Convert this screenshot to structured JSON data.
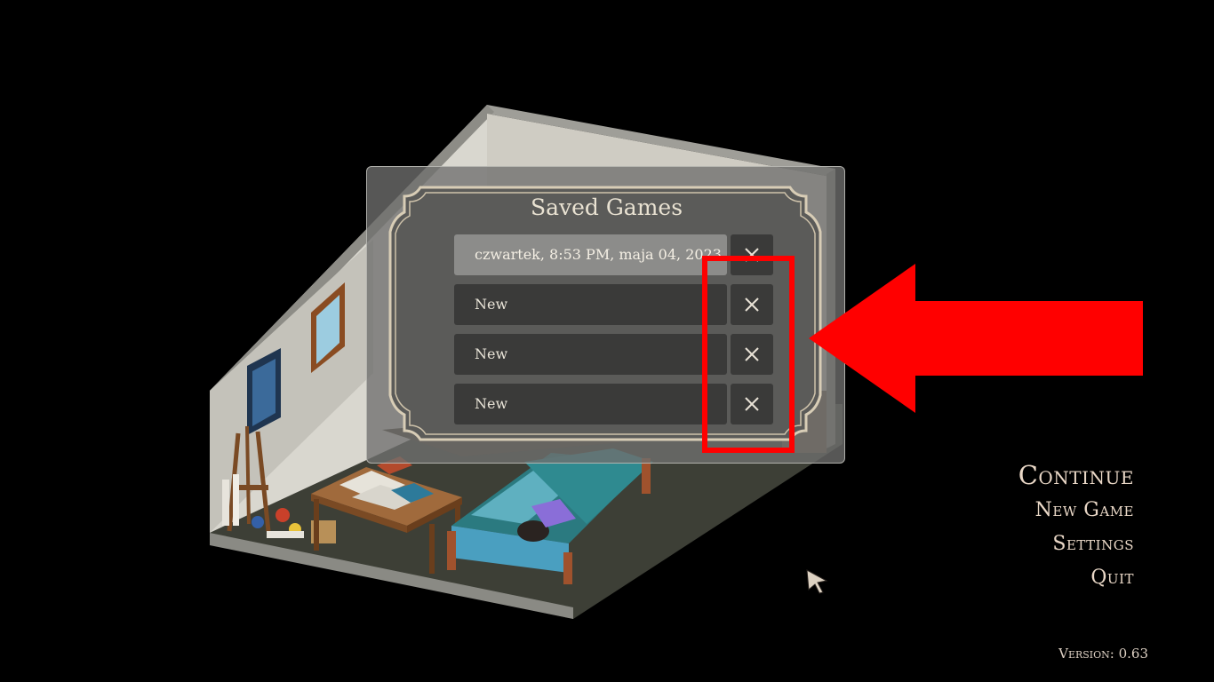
{
  "saved_games": {
    "title": "Saved Games",
    "slots": [
      {
        "label": "czwartek, 8:53 PM, maja 04, 2023",
        "selected": true
      },
      {
        "label": "New",
        "selected": false
      },
      {
        "label": "New",
        "selected": false
      },
      {
        "label": "New",
        "selected": false
      }
    ],
    "delete_icon": "close-icon"
  },
  "menu": {
    "continue": "Continue",
    "new_game": "New Game",
    "settings": "Settings",
    "quit": "Quit"
  },
  "version_text": "Version: 0.63",
  "colors": {
    "background": "#000000",
    "menu_text": "#ead8c7",
    "annotation": "#ff0000",
    "panel": "#70706e",
    "slot": "#3a3a39",
    "slot_selected": "#8c8c8a"
  }
}
